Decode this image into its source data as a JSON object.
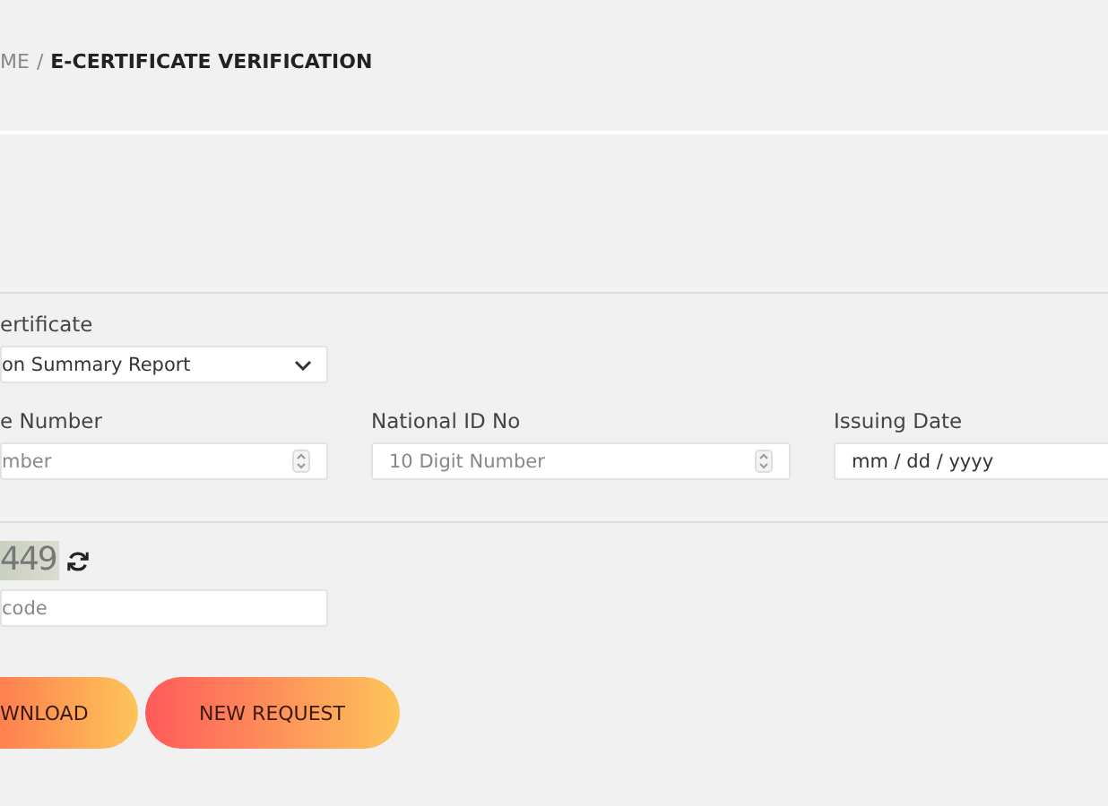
{
  "breadcrumb": {
    "parent": "ME",
    "separator": "/",
    "current": "E-CERTIFICATE VERIFICATION"
  },
  "certificate": {
    "label": "ertificate",
    "value": "on Summary Report"
  },
  "fields": [
    {
      "label": "e Number",
      "placeholder": "mber",
      "kind": "number"
    },
    {
      "label": "National ID No",
      "placeholder": "10 Digit Number",
      "kind": "number"
    },
    {
      "label": "Issuing Date",
      "placeholder": "mm / dd / yyyy",
      "kind": "date"
    }
  ],
  "captcha": {
    "code": "449",
    "placeholder": "code"
  },
  "buttons": [
    "WNLOAD",
    "NEW REQUEST"
  ]
}
